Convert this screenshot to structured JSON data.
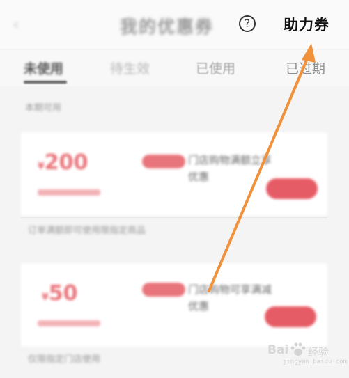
{
  "header": {
    "title": "我的优惠券",
    "help_icon": "?",
    "assist_label": "助力券"
  },
  "tabs": [
    {
      "label": "未使用",
      "active": true
    },
    {
      "label": "待生效",
      "active": false
    },
    {
      "label": "已使用",
      "active": false
    },
    {
      "label": "已过期",
      "active": false
    }
  ],
  "section_label": "本期可用",
  "coupons": [
    {
      "currency": "¥",
      "amount": "200",
      "description": "门店购物满额立享优惠",
      "footnote": "订单满额即可使用限指定商品"
    },
    {
      "currency": "¥",
      "amount": "50",
      "description": "门店购物可享满减优惠",
      "footnote": "仅限指定门店使用"
    }
  ],
  "watermark": {
    "logo_text": "Bai",
    "logo_cn": "经验",
    "url": "jingyan.baidu.com"
  },
  "colors": {
    "accent": "#e9757c",
    "arrow": "#f0913b"
  }
}
